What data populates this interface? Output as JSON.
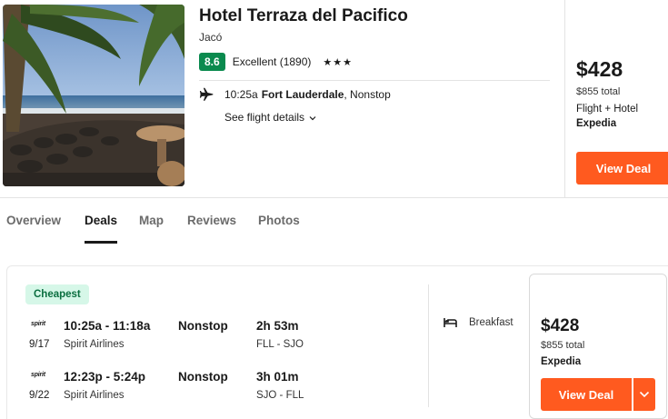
{
  "hotel": {
    "name": "Hotel Terraza del Pacifico",
    "city": "Jacó",
    "score": "8.6",
    "rating_text": "Excellent (1890)",
    "stars": "★★★",
    "stars_count": 3
  },
  "flight_summary": {
    "time": "10:25a",
    "city": "Fort Lauderdale",
    "stops": ", Nonstop",
    "details_link": "See flight details"
  },
  "price_panel": {
    "price": "$428",
    "total": "$855 total",
    "type": "Flight + Hotel",
    "vendor": "Expedia",
    "button": "View Deal"
  },
  "tabs": [
    {
      "label": "Overview",
      "active": false
    },
    {
      "label": "Deals",
      "active": true
    },
    {
      "label": "Map",
      "active": false
    },
    {
      "label": "Reviews",
      "active": false
    },
    {
      "label": "Photos",
      "active": false
    }
  ],
  "deal": {
    "badge": "Cheapest",
    "legs": [
      {
        "logo": "spirit",
        "date": "9/17",
        "times": "10:25a - 11:18a",
        "airline": "Spirit Airlines",
        "stops": "Nonstop",
        "duration": "2h 53m",
        "route": "FLL - SJO"
      },
      {
        "logo": "spirit",
        "date": "9/22",
        "times": "12:23p - 5:24p",
        "airline": "Spirit Airlines",
        "stops": "Nonstop",
        "duration": "3h 01m",
        "route": "SJO - FLL"
      }
    ],
    "amenity": "Breakfast",
    "price": "$428",
    "total": "$855 total",
    "vendor": "Expedia",
    "button": "View Deal"
  },
  "colors": {
    "accent": "#ff5a1f",
    "score_badge": "#0a8a4e",
    "cheapest_badge_bg": "#d6f7e8"
  },
  "icons": [
    "plane-icon",
    "chevron-down-icon",
    "bed-icon"
  ]
}
